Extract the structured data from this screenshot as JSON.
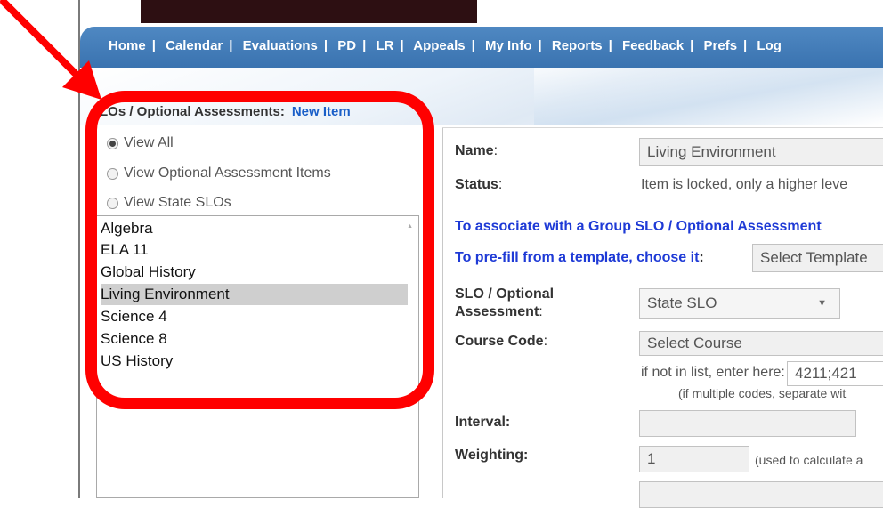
{
  "nav": {
    "items": [
      "Home",
      "Calendar",
      "Evaluations",
      "PD",
      "LR",
      "Appeals",
      "My Info",
      "Reports",
      "Feedback",
      "Prefs",
      "Log"
    ]
  },
  "left": {
    "header": "LOs / Optional Assessments:",
    "new_item": "New Item",
    "radios": [
      "View All",
      "View Optional Assessment Items",
      "View State SLOs"
    ],
    "list": [
      "Algebra",
      "ELA 11",
      "Global History",
      "Living Environment",
      "Science 4",
      "Science 8",
      "US History"
    ],
    "selected_index": 3
  },
  "form": {
    "name_label": "Name",
    "name_value": "Living Environment",
    "status_label": "Status",
    "status_value": "Item is locked, only a higher leve",
    "associate_text": "To associate with a Group SLO / Optional Assessment",
    "prefill_text": "To pre-fill from a template, choose it",
    "template_placeholder": "Select Template",
    "slo_label_line1": "SLO / Optional",
    "slo_label_line2": "Assessment",
    "slo_value": "State SLO",
    "course_code_label": "Course Code",
    "course_placeholder": "Select Course",
    "not_in_list": "if not in list, enter here:",
    "course_code_value": "4211;421",
    "multiple_codes_hint": "(if multiple codes, separate wit",
    "interval_label": "Interval:",
    "interval_value": "",
    "weighting_label": "Weighting:",
    "weighting_value": "1",
    "weighting_hint": "(used to calculate a"
  },
  "colors": {
    "nav_bg": "#3f7bb8",
    "annotation": "#ff0000",
    "link_blue": "#1e3ad6"
  }
}
